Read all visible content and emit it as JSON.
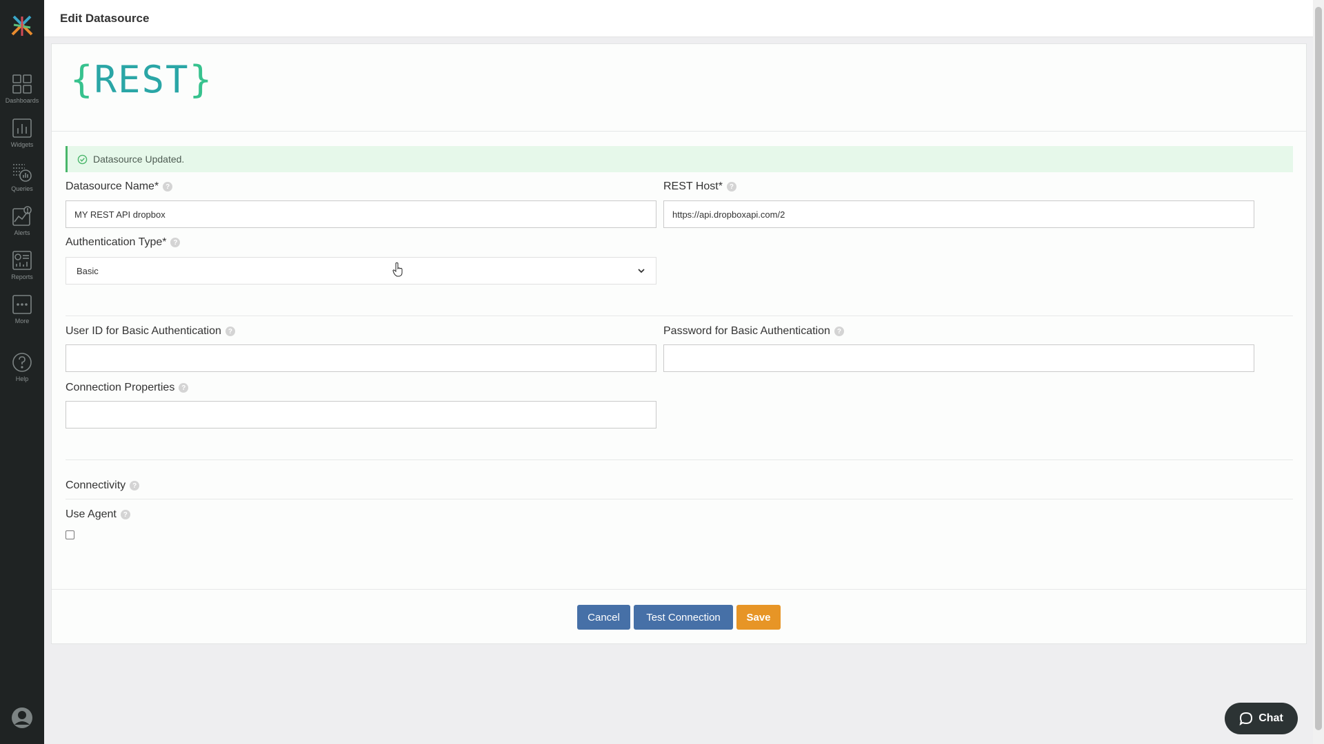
{
  "sidebar": {
    "items": [
      {
        "label": "Dashboards",
        "icon": "dashboards-icon"
      },
      {
        "label": "Widgets",
        "icon": "widgets-icon"
      },
      {
        "label": "Queries",
        "icon": "queries-icon"
      },
      {
        "label": "Alerts",
        "icon": "alerts-icon"
      },
      {
        "label": "Reports",
        "icon": "reports-icon"
      },
      {
        "label": "More",
        "icon": "more-icon"
      }
    ],
    "help_label": "Help"
  },
  "header": {
    "title": "Edit Datasource"
  },
  "brand": {
    "open_brace": "{",
    "name": "REST",
    "close_brace": "}"
  },
  "alert": {
    "message": "Datasource Updated."
  },
  "form": {
    "datasource_name": {
      "label": "Datasource Name*",
      "value": "MY REST API dropbox"
    },
    "rest_host": {
      "label": "REST Host*",
      "value": "https://api.dropboxapi.com/2"
    },
    "auth_type": {
      "label": "Authentication Type*",
      "value": "Basic"
    },
    "user_id": {
      "label": "User ID for Basic Authentication",
      "value": ""
    },
    "password": {
      "label": "Password for Basic Authentication",
      "value": ""
    },
    "connection_properties": {
      "label": "Connection Properties",
      "value": ""
    },
    "connectivity": {
      "label": "Connectivity"
    },
    "use_agent": {
      "label": "Use Agent",
      "checked": false
    }
  },
  "buttons": {
    "cancel": "Cancel",
    "test_connection": "Test Connection",
    "save": "Save"
  },
  "chat": {
    "label": "Chat"
  },
  "colors": {
    "sidebar_bg": "#1f2323",
    "brand_teal": "#2aa6a6",
    "brand_green": "#37c28e",
    "button_blue": "#4670a7",
    "button_orange": "#e79526",
    "alert_bg": "#e6f8ea"
  }
}
